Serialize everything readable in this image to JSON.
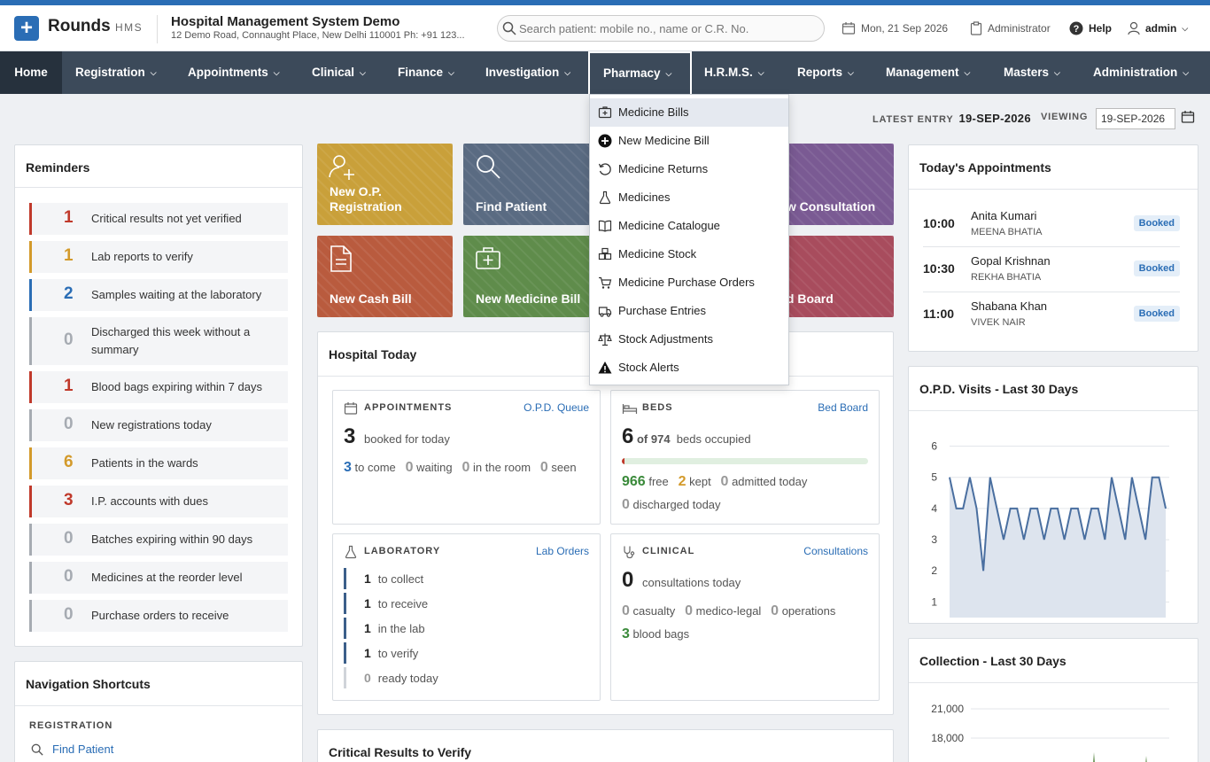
{
  "brand": {
    "name": "Rounds",
    "sub": "HMS"
  },
  "hospital": {
    "name": "Hospital Management System Demo",
    "address": "12 Demo Road, Connaught Place, New Delhi 110001 Ph: +91 123..."
  },
  "search": {
    "placeholder": "Search patient: mobile no., name or C.R. No."
  },
  "header": {
    "date": "Mon, 21 Sep 2026",
    "role": "Administrator",
    "help": "Help",
    "user": "admin"
  },
  "nav": {
    "items": [
      "Home",
      "Registration",
      "Appointments",
      "Clinical",
      "Finance",
      "Investigation",
      "Pharmacy",
      "H.R.M.S.",
      "Reports",
      "Management",
      "Masters",
      "Administration"
    ]
  },
  "pharmacy_menu": {
    "items": [
      {
        "label": "Medicine Bills",
        "icon": "medicine-bill-icon"
      },
      {
        "label": "New Medicine Bill",
        "icon": "plus-circle-icon"
      },
      {
        "label": "Medicine Returns",
        "icon": "undo-icon"
      },
      {
        "label": "Medicines",
        "icon": "flask-icon"
      },
      {
        "label": "Medicine Catalogue",
        "icon": "book-icon"
      },
      {
        "label": "Medicine Stock",
        "icon": "stock-icon"
      },
      {
        "label": "Medicine Purchase Orders",
        "icon": "cart-icon"
      },
      {
        "label": "Purchase Entries",
        "icon": "truck-icon"
      },
      {
        "label": "Stock Adjustments",
        "icon": "scale-icon"
      },
      {
        "label": "Stock Alerts",
        "icon": "warning-icon"
      }
    ]
  },
  "meta": {
    "latest_entry_label": "LATEST ENTRY",
    "latest_entry": "19-SEP-2026",
    "viewing_label": "VIEWING",
    "viewing": "19-SEP-2026"
  },
  "reminders": {
    "title": "Reminders",
    "items": [
      {
        "count": "1",
        "text": "Critical results not yet verified",
        "color": "#c0392b"
      },
      {
        "count": "1",
        "text": "Lab reports to verify",
        "color": "#d39a2b"
      },
      {
        "count": "2",
        "text": "Samples waiting at the laboratory",
        "color": "#2a6db5"
      },
      {
        "count": "0",
        "text": "Discharged this week without a summary",
        "color": "#a6abb2"
      },
      {
        "count": "1",
        "text": "Blood bags expiring within 7 days",
        "color": "#c0392b"
      },
      {
        "count": "0",
        "text": "New registrations today",
        "color": "#a6abb2"
      },
      {
        "count": "6",
        "text": "Patients in the wards",
        "color": "#d39a2b"
      },
      {
        "count": "3",
        "text": "I.P. accounts with dues",
        "color": "#c0392b"
      },
      {
        "count": "0",
        "text": "Batches expiring within 90 days",
        "color": "#a6abb2"
      },
      {
        "count": "0",
        "text": "Medicines at the reorder level",
        "color": "#a6abb2"
      },
      {
        "count": "0",
        "text": "Purchase orders to receive",
        "color": "#a6abb2"
      }
    ]
  },
  "shortcuts": {
    "title": "Navigation Shortcuts",
    "section": "REGISTRATION",
    "find_patient": "Find Patient"
  },
  "tiles": [
    {
      "label": "New O.P. Registration",
      "color": "#c9a03a"
    },
    {
      "label": "Find Patient",
      "color": "#5a6b82"
    },
    {
      "label": "New Consultation",
      "color": "#7a5a93"
    },
    {
      "label": "New Cash Bill",
      "color": "#b95b3e"
    },
    {
      "label": "New Medicine Bill",
      "color": "#5f8c4b"
    },
    {
      "label": "Bed Board",
      "color": "#a84c5d"
    }
  ],
  "hospital_today": {
    "title": "Hospital Today",
    "appointments": {
      "title": "APPOINTMENTS",
      "link": "O.P.D. Queue",
      "booked": "3",
      "booked_label": "booked for today",
      "to_come": "3",
      "to_come_label": "to come",
      "waiting": "0",
      "waiting_label": "waiting",
      "in_room": "0",
      "in_room_label": "in the room",
      "seen": "0",
      "seen_label": "seen"
    },
    "beds": {
      "title": "BEDS",
      "link": "Bed Board",
      "occupied": "6",
      "of_total": "of 974",
      "occupied_label": "beds occupied",
      "occupancy_fraction": 0.006,
      "free": "966",
      "free_label": "free",
      "kept": "2",
      "kept_label": "kept",
      "admitted": "0",
      "admitted_label": "admitted today",
      "discharged": "0",
      "discharged_label": "discharged today"
    },
    "laboratory": {
      "title": "LABORATORY",
      "link": "Lab Orders",
      "rows": [
        {
          "count": "1",
          "label": "to collect"
        },
        {
          "count": "1",
          "label": "to receive"
        },
        {
          "count": "1",
          "label": "in the lab"
        },
        {
          "count": "1",
          "label": "to verify"
        },
        {
          "count": "0",
          "label": "ready today"
        }
      ]
    },
    "clinical": {
      "title": "CLINICAL",
      "link": "Consultations",
      "consultations": "0",
      "consultations_label": "consultations today",
      "casualty": "0",
      "casualty_label": "casualty",
      "medico_legal": "0",
      "medico_legal_label": "medico-legal",
      "operations": "0",
      "operations_label": "operations",
      "blood_bags": "3",
      "blood_bags_label": "blood bags"
    }
  },
  "critical": {
    "title": "Critical Results to Verify"
  },
  "todays_appointments": {
    "title": "Today's Appointments",
    "items": [
      {
        "time": "10:00",
        "patient": "Anita Kumari",
        "doctor": "MEENA BHATIA",
        "status": "Booked"
      },
      {
        "time": "10:30",
        "patient": "Gopal Krishnan",
        "doctor": "REKHA BHATIA",
        "status": "Booked"
      },
      {
        "time": "11:00",
        "patient": "Shabana Khan",
        "doctor": "VIVEK NAIR",
        "status": "Booked"
      }
    ]
  },
  "chart_data": [
    {
      "type": "area",
      "title": "O.P.D. Visits - Last 30 Days",
      "ylim": [
        0.5,
        6.3
      ],
      "yticks": [
        "6",
        "5",
        "4",
        "3",
        "2",
        "1"
      ],
      "series": [
        {
          "values": [
            5,
            4,
            4,
            5,
            4,
            2,
            5,
            4,
            3,
            4,
            4,
            3,
            4,
            4,
            3,
            4,
            4,
            3,
            4,
            4,
            3,
            4,
            4,
            3,
            5,
            4,
            3,
            5,
            4,
            3,
            5,
            5,
            4
          ]
        }
      ],
      "grid": true,
      "color": "#4a6fa0"
    },
    {
      "type": "area",
      "title": "Collection - Last 30 Days",
      "yticks": [
        "21,000",
        "18,000"
      ],
      "ylim": [
        14000,
        22000
      ],
      "color": "#5f8c4b"
    }
  ]
}
